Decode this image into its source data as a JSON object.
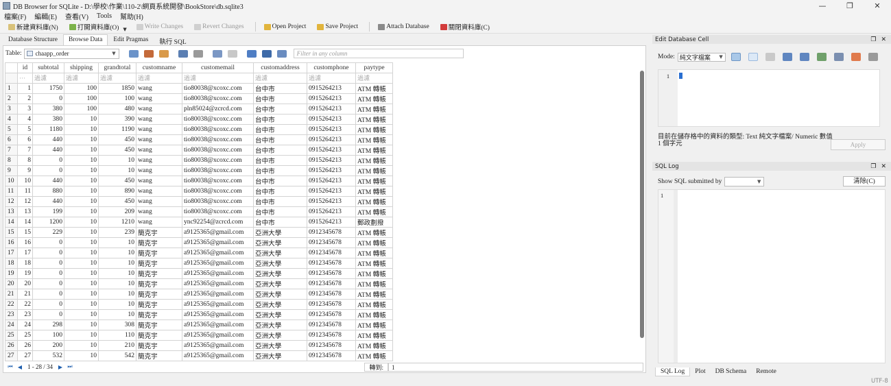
{
  "window": {
    "title": "DB Browser for SQLite - D:\\學校\\作業\\110-2\\網頁系統開發\\BookStore\\db.sqlite3"
  },
  "menu": [
    "檔案(F)",
    "編輯(E)",
    "查看(V)",
    "Tools",
    "幫助(H)"
  ],
  "toolbar": {
    "new_db": "新建資料庫(N)",
    "open_db": "打開資料庫(O)",
    "write_changes": "Write Changes",
    "revert_changes": "Revert Changes",
    "open_project": "Open Project",
    "save_project": "Save Project",
    "attach_db": "Attach Database",
    "close_db": "關閉資料庫(C)"
  },
  "main_tabs": [
    "Database Structure",
    "Browse Data",
    "Edit Pragmas",
    "執行 SQL"
  ],
  "browse": {
    "table_label": "Table:",
    "table_name": "chaapp_order",
    "filter_placeholder": "Filter in any column",
    "filter_cell": "過濾",
    "filter_row_first": "···",
    "columns": [
      "id",
      "subtotal",
      "shipping",
      "grandtotal",
      "customname",
      "customemail",
      "customaddress",
      "customphone",
      "paytype"
    ],
    "rows": [
      [
        "1",
        "1",
        "1750",
        "100",
        "1850",
        "wang",
        "tio80038@xcoxc.com",
        "台中市",
        "0915264213",
        "ATM 轉帳"
      ],
      [
        "2",
        "2",
        "0",
        "100",
        "100",
        "wang",
        "tio80038@xcoxc.com",
        "台中市",
        "0915264213",
        "ATM 轉帳"
      ],
      [
        "3",
        "3",
        "380",
        "100",
        "480",
        "wang",
        "pln85024@zcrcd.com",
        "台中市",
        "0915264213",
        "ATM 轉帳"
      ],
      [
        "4",
        "4",
        "380",
        "10",
        "390",
        "wang",
        "tio80038@xcoxc.com",
        "台中市",
        "0915264213",
        "ATM 轉帳"
      ],
      [
        "5",
        "5",
        "1180",
        "10",
        "1190",
        "wang",
        "tio80038@xcoxc.com",
        "台中市",
        "0915264213",
        "ATM 轉帳"
      ],
      [
        "6",
        "6",
        "440",
        "10",
        "450",
        "wang",
        "tio80038@xcoxc.com",
        "台中市",
        "0915264213",
        "ATM 轉帳"
      ],
      [
        "7",
        "7",
        "440",
        "10",
        "450",
        "wang",
        "tio80038@xcoxc.com",
        "台中市",
        "0915264213",
        "ATM 轉帳"
      ],
      [
        "8",
        "8",
        "0",
        "10",
        "10",
        "wang",
        "tio80038@xcoxc.com",
        "台中市",
        "0915264213",
        "ATM 轉帳"
      ],
      [
        "9",
        "9",
        "0",
        "10",
        "10",
        "wang",
        "tio80038@xcoxc.com",
        "台中市",
        "0915264213",
        "ATM 轉帳"
      ],
      [
        "10",
        "10",
        "440",
        "10",
        "450",
        "wang",
        "tio80038@xcoxc.com",
        "台中市",
        "0915264213",
        "ATM 轉帳"
      ],
      [
        "11",
        "11",
        "880",
        "10",
        "890",
        "wang",
        "tio80038@xcoxc.com",
        "台中市",
        "0915264213",
        "ATM 轉帳"
      ],
      [
        "12",
        "12",
        "440",
        "10",
        "450",
        "wang",
        "tio80038@xcoxc.com",
        "台中市",
        "0915264213",
        "ATM 轉帳"
      ],
      [
        "13",
        "13",
        "199",
        "10",
        "209",
        "wang",
        "tio80038@xcoxc.com",
        "台中市",
        "0915264213",
        "ATM 轉帳"
      ],
      [
        "14",
        "14",
        "1200",
        "10",
        "1210",
        "wang",
        "ync92254@zcrcd.com",
        "台中市",
        "0915264213",
        "郵政劃撥"
      ],
      [
        "15",
        "15",
        "229",
        "10",
        "239",
        "簡克宇",
        "a9125365@gmail.com",
        "亞洲大學",
        "0912345678",
        "ATM 轉帳"
      ],
      [
        "16",
        "16",
        "0",
        "10",
        "10",
        "簡克宇",
        "a9125365@gmail.com",
        "亞洲大學",
        "0912345678",
        "ATM 轉帳"
      ],
      [
        "17",
        "17",
        "0",
        "10",
        "10",
        "簡克宇",
        "a9125365@gmail.com",
        "亞洲大學",
        "0912345678",
        "ATM 轉帳"
      ],
      [
        "18",
        "18",
        "0",
        "10",
        "10",
        "簡克宇",
        "a9125365@gmail.com",
        "亞洲大學",
        "0912345678",
        "ATM 轉帳"
      ],
      [
        "19",
        "19",
        "0",
        "10",
        "10",
        "簡克宇",
        "a9125365@gmail.com",
        "亞洲大學",
        "0912345678",
        "ATM 轉帳"
      ],
      [
        "20",
        "20",
        "0",
        "10",
        "10",
        "簡克宇",
        "a9125365@gmail.com",
        "亞洲大學",
        "0912345678",
        "ATM 轉帳"
      ],
      [
        "21",
        "21",
        "0",
        "10",
        "10",
        "簡克宇",
        "a9125365@gmail.com",
        "亞洲大學",
        "0912345678",
        "ATM 轉帳"
      ],
      [
        "22",
        "22",
        "0",
        "10",
        "10",
        "簡克宇",
        "a9125365@gmail.com",
        "亞洲大學",
        "0912345678",
        "ATM 轉帳"
      ],
      [
        "23",
        "23",
        "0",
        "10",
        "10",
        "簡克宇",
        "a9125365@gmail.com",
        "亞洲大學",
        "0912345678",
        "ATM 轉帳"
      ],
      [
        "24",
        "24",
        "298",
        "10",
        "308",
        "簡克宇",
        "a9125365@gmail.com",
        "亞洲大學",
        "0912345678",
        "ATM 轉帳"
      ],
      [
        "25",
        "25",
        "100",
        "10",
        "110",
        "簡克宇",
        "a9125365@gmail.com",
        "亞洲大學",
        "0912345678",
        "ATM 轉帳"
      ],
      [
        "26",
        "26",
        "200",
        "10",
        "210",
        "簡克宇",
        "a9125365@gmail.com",
        "亞洲大學",
        "0912345678",
        "ATM 轉帳"
      ],
      [
        "27",
        "27",
        "532",
        "10",
        "542",
        "簡克宇",
        "a9125365@gmail.com",
        "亞洲大學",
        "0912345678",
        "ATM 轉帳"
      ]
    ],
    "pager_text": "1 - 28 / 34",
    "goto_label": "轉到:",
    "goto_value": "1"
  },
  "edit_cell": {
    "title": "Edit Database Cell",
    "mode_label": "Mode:",
    "mode_value": "純文字檔案",
    "line_number": "1",
    "type_info": "目前在儲存格中的資料的類型: Text 純文字檔案/ Numeric 數值",
    "size_info": "1 個字元",
    "apply_label": "Apply"
  },
  "sql_log": {
    "title": "SQL Log",
    "show_label": "Show SQL submitted by",
    "clear_label": "清除(C)",
    "line_number": "1"
  },
  "bottom_tabs": [
    "SQL Log",
    "Plot",
    "DB Schema",
    "Remote"
  ],
  "status": {
    "encoding": "UTF-8"
  }
}
